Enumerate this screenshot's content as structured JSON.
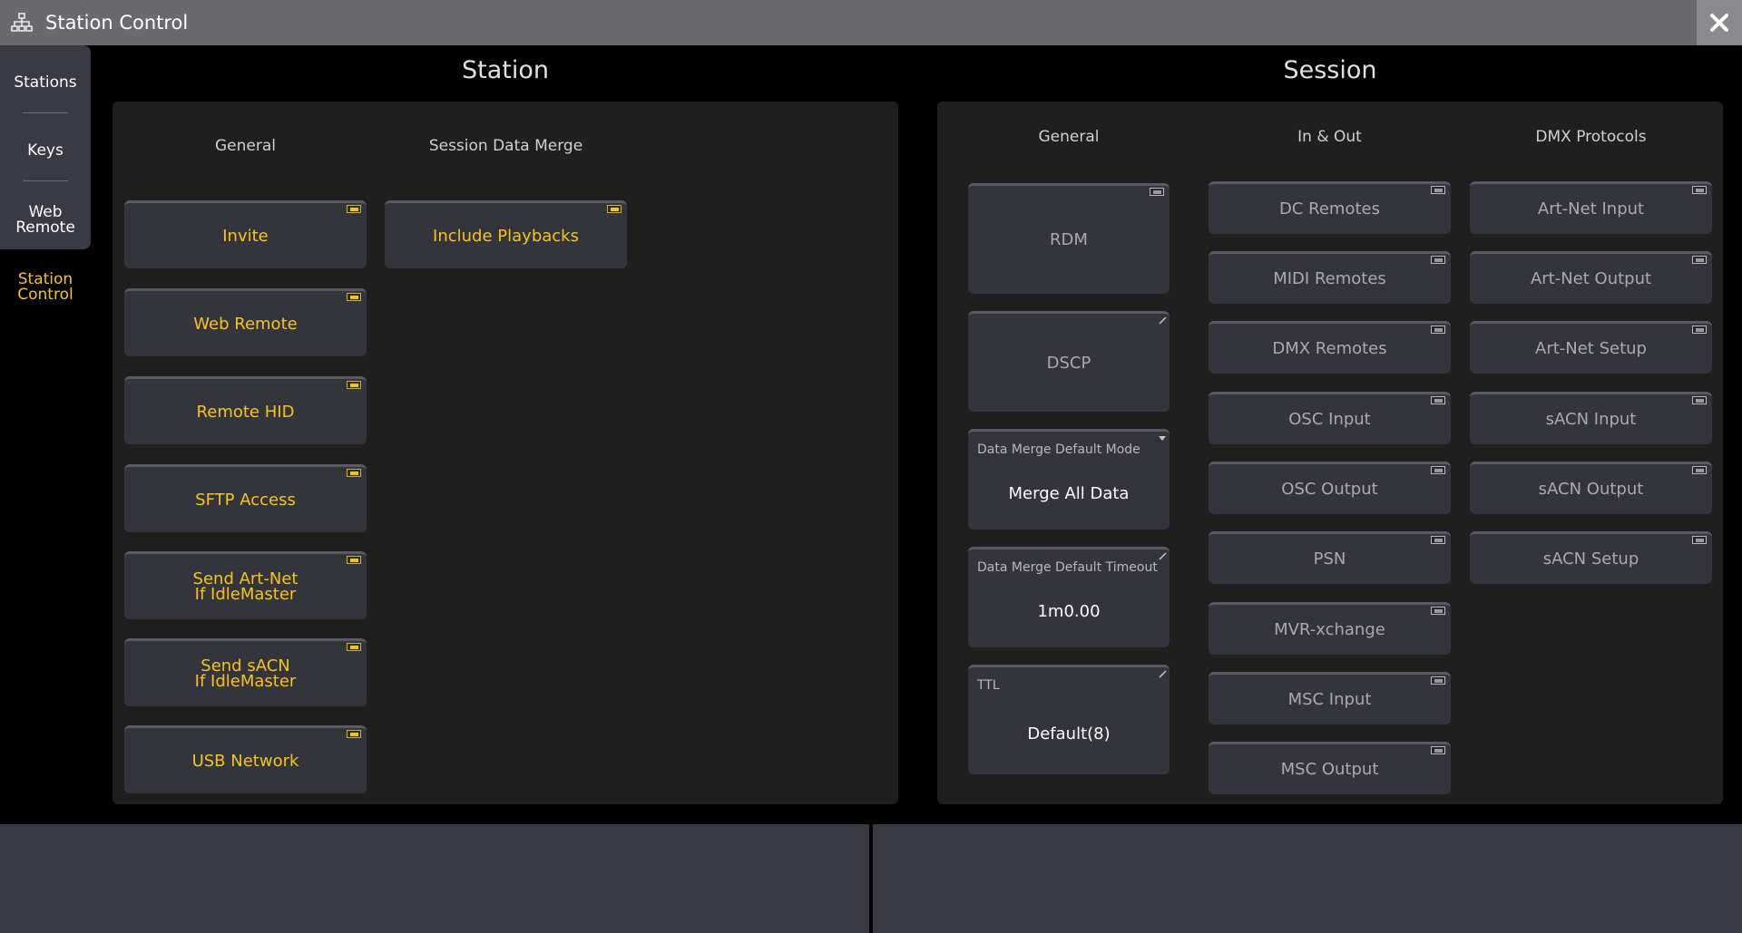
{
  "window": {
    "title": "Station Control",
    "icon": "network-icon",
    "close_icon": "close-icon"
  },
  "sidenav": {
    "items": [
      {
        "label": "Stations"
      },
      {
        "label": "Keys"
      },
      {
        "label": "Web\nRemote"
      }
    ],
    "active": {
      "label": "Station\nControl"
    }
  },
  "station": {
    "title": "Station",
    "columns": {
      "general": "General",
      "merge": "Session Data Merge"
    },
    "general_buttons": [
      {
        "label": "Invite"
      },
      {
        "label": "Web Remote"
      },
      {
        "label": "Remote HID"
      },
      {
        "label": "SFTP Access"
      },
      {
        "label": "Send Art-Net\nIf IdleMaster"
      },
      {
        "label": "Send sACN\nIf IdleMaster"
      },
      {
        "label": "USB Network"
      }
    ],
    "merge_buttons": [
      {
        "label": "Include Playbacks"
      }
    ]
  },
  "session": {
    "title": "Session",
    "columns": {
      "general": "General",
      "in_out": "In & Out",
      "dmx": "DMX Protocols"
    },
    "general": {
      "rdm": "RDM",
      "dscp": "DSCP",
      "merge_mode": {
        "label": "Data Merge Default Mode",
        "value": "Merge All Data"
      },
      "merge_timeout": {
        "label": "Data Merge Default Timeout",
        "value": "1m0.00"
      },
      "ttl": {
        "label": "TTL",
        "value": "Default(8)"
      }
    },
    "in_out_buttons": [
      {
        "label": "DC Remotes"
      },
      {
        "label": "MIDI Remotes"
      },
      {
        "label": "DMX Remotes"
      },
      {
        "label": "OSC Input"
      },
      {
        "label": "OSC Output"
      },
      {
        "label": "PSN"
      },
      {
        "label": "MVR-xchange"
      },
      {
        "label": "MSC Input"
      },
      {
        "label": "MSC Output"
      }
    ],
    "dmx_buttons": [
      {
        "label": "Art-Net Input"
      },
      {
        "label": "Art-Net Output"
      },
      {
        "label": "Art-Net Setup"
      },
      {
        "label": "sACN Input"
      },
      {
        "label": "sACN Output"
      },
      {
        "label": "sACN Setup"
      }
    ]
  },
  "colors": {
    "active": "#f5c518",
    "inactive": "#a9a9ae",
    "panel": "#1f1f1f",
    "button": "#34343c"
  }
}
